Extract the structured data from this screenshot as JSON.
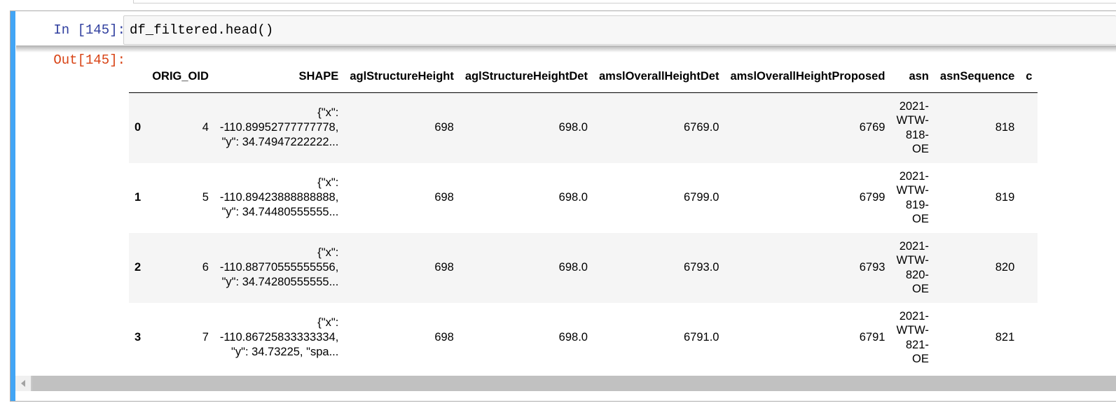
{
  "cell": {
    "in_prompt": "In [145]:",
    "out_prompt": "Out[145]:",
    "code": "df_filtered.head()",
    "accent_color": "#42a5f5"
  },
  "table": {
    "columns": [
      "ORIG_OID",
      "SHAPE",
      "aglStructureHeight",
      "aglStructureHeightDet",
      "amslOverallHeightDet",
      "amslOverallHeightProposed",
      "asn",
      "asnSequence",
      "c"
    ],
    "rows": [
      {
        "index": "0",
        "ORIG_OID": "4",
        "SHAPE": [
          "{\"x\":",
          "-110.89952777777778,",
          "\"y\": 34.74947222222..."
        ],
        "aglStructureHeight": "698",
        "aglStructureHeightDet": "698.0",
        "amslOverallHeightDet": "6769.0",
        "amslOverallHeightProposed": "6769",
        "asn": [
          "2021-",
          "WTW-",
          "818-",
          "OE"
        ],
        "asnSequence": "818"
      },
      {
        "index": "1",
        "ORIG_OID": "5",
        "SHAPE": [
          "{\"x\":",
          "-110.89423888888888,",
          "\"y\": 34.74480555555..."
        ],
        "aglStructureHeight": "698",
        "aglStructureHeightDet": "698.0",
        "amslOverallHeightDet": "6799.0",
        "amslOverallHeightProposed": "6799",
        "asn": [
          "2021-",
          "WTW-",
          "819-",
          "OE"
        ],
        "asnSequence": "819"
      },
      {
        "index": "2",
        "ORIG_OID": "6",
        "SHAPE": [
          "{\"x\":",
          "-110.88770555555556,",
          "\"y\": 34.74280555555..."
        ],
        "aglStructureHeight": "698",
        "aglStructureHeightDet": "698.0",
        "amslOverallHeightDet": "6793.0",
        "amslOverallHeightProposed": "6793",
        "asn": [
          "2021-",
          "WTW-",
          "820-",
          "OE"
        ],
        "asnSequence": "820"
      },
      {
        "index": "3",
        "ORIG_OID": "7",
        "SHAPE": [
          "{\"x\":",
          "-110.86725833333334,",
          "\"y\": 34.73225, \"spa..."
        ],
        "aglStructureHeight": "698",
        "aglStructureHeightDet": "698.0",
        "amslOverallHeightDet": "6791.0",
        "amslOverallHeightProposed": "6791",
        "asn": [
          "2021-",
          "WTW-",
          "821-",
          "OE"
        ],
        "asnSequence": "821"
      }
    ]
  },
  "scrollbar": {
    "left_icon": "chevron-left-icon"
  }
}
